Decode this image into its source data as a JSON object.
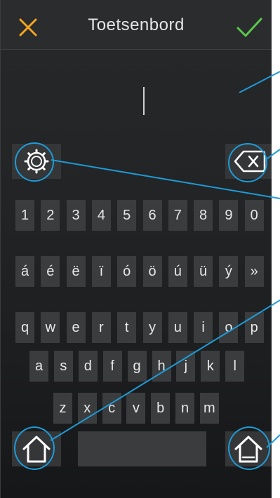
{
  "header": {
    "title": "Toetsenbord",
    "cancel_icon": "close-icon",
    "confirm_icon": "check-icon"
  },
  "colors": {
    "cancel": "#f4a620",
    "confirm": "#5bc84c",
    "callout": "#1e9bd7",
    "background": "#222426"
  },
  "input": {
    "value": ""
  },
  "rows": {
    "numbers": [
      "1",
      "2",
      "3",
      "4",
      "5",
      "6",
      "7",
      "8",
      "9",
      "0"
    ],
    "accents": [
      "á",
      "é",
      "ë",
      "ï",
      "ó",
      "ö",
      "ú",
      "ü",
      "ý",
      "»"
    ],
    "row1": [
      "q",
      "w",
      "e",
      "r",
      "t",
      "y",
      "u",
      "i",
      "o",
      "p"
    ],
    "row2": [
      "a",
      "s",
      "d",
      "f",
      "g",
      "h",
      "j",
      "k",
      "l"
    ],
    "row3": [
      "z",
      "x",
      "c",
      "v",
      "b",
      "n",
      "m"
    ]
  },
  "icons": {
    "settings": "gear-icon",
    "backspace": "backspace-icon",
    "home_left": "home-icon",
    "home_right": "home-underline-icon"
  }
}
